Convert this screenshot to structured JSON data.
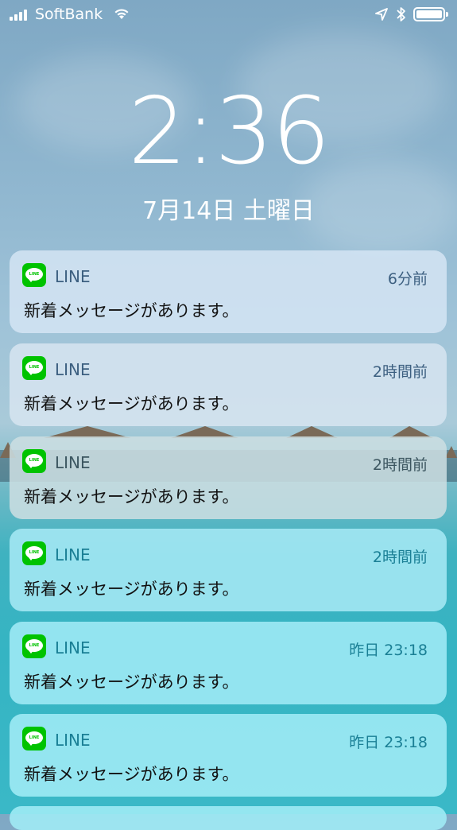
{
  "status_bar": {
    "carrier": "SoftBank",
    "signal_bars": 4,
    "icons": [
      "signal-icon",
      "wifi-icon",
      "location-arrow-icon",
      "bluetooth-icon",
      "battery-icon"
    ],
    "battery_level": 1.0
  },
  "lock": {
    "time": "2:36",
    "date": "7月14日 土曜日"
  },
  "notifications": [
    {
      "app": "LINE",
      "time": "6分前",
      "message": "新着メッセージがあります。"
    },
    {
      "app": "LINE",
      "time": "2時間前",
      "message": "新着メッセージがあります。"
    },
    {
      "app": "LINE",
      "time": "2時間前",
      "message": "新着メッセージがあります。"
    },
    {
      "app": "LINE",
      "time": "2時間前",
      "message": "新着メッセージがあります。"
    },
    {
      "app": "LINE",
      "time": "昨日 23:18",
      "message": "新着メッセージがあります。"
    },
    {
      "app": "LINE",
      "time": "昨日 23:18",
      "message": "新着メッセージがあります。"
    }
  ],
  "colors": {
    "line_green": "#00c300"
  }
}
